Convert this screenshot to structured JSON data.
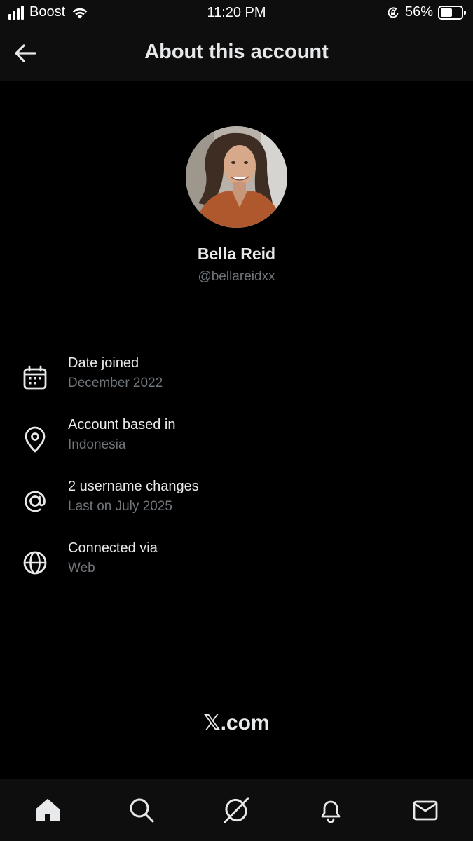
{
  "status_bar": {
    "carrier": "Boost",
    "time": "11:20 PM",
    "battery_percent": "56%",
    "battery_level": 0.56,
    "icons": [
      "signal-icon",
      "wifi-icon",
      "orientation-lock-icon",
      "battery-icon"
    ]
  },
  "header": {
    "title": "About this account",
    "back_icon": "back-arrow-icon"
  },
  "profile": {
    "name": "Bella Reid",
    "handle": "@bellareidxx"
  },
  "info": [
    {
      "icon": "calendar-icon",
      "title": "Date joined",
      "value": "December 2022"
    },
    {
      "icon": "location-pin-icon",
      "title": "Account based in",
      "value": "Indonesia"
    },
    {
      "icon": "at-sign-icon",
      "title": "2 username changes",
      "value": "Last on July 2025"
    },
    {
      "icon": "globe-icon",
      "title": "Connected via",
      "value": "Web"
    }
  ],
  "footer": {
    "brand_x": "𝕏",
    "brand_suffix": ".com"
  },
  "tab_bar": {
    "tabs": [
      "home-icon",
      "search-icon",
      "grok-icon",
      "notifications-icon",
      "messages-icon"
    ],
    "active": "home-icon"
  },
  "colors": {
    "background": "#000000",
    "bar_background": "#0e0e0e",
    "primary_text": "#e7e9ea",
    "secondary_text": "#71767b",
    "divider": "#2f3336"
  }
}
